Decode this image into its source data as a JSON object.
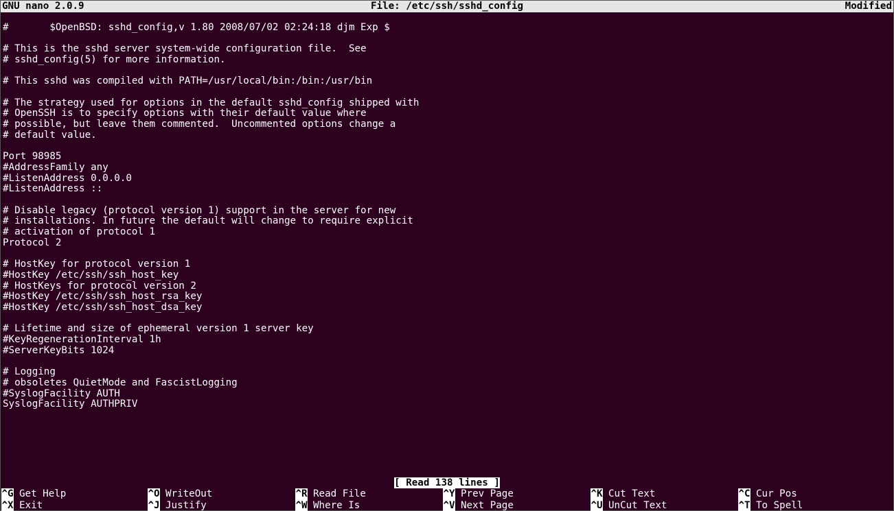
{
  "titlebar": {
    "app": "  GNU nano 2.0.9",
    "file": "File: /etc/ssh/sshd_config",
    "status": "Modified  "
  },
  "content": [
    "",
    "#       $OpenBSD: sshd_config,v 1.80 2008/07/02 02:24:18 djm Exp $",
    "",
    "# This is the sshd server system-wide configuration file.  See",
    "# sshd_config(5) for more information.",
    "",
    "# This sshd was compiled with PATH=/usr/local/bin:/bin:/usr/bin",
    "",
    "# The strategy used for options in the default sshd_config shipped with",
    "# OpenSSH is to specify options with their default value where",
    "# possible, but leave them commented.  Uncommented options change a",
    "# default value.",
    "",
    "Port 98985",
    "#AddressFamily any",
    "#ListenAddress 0.0.0.0",
    "#ListenAddress ::",
    "",
    "# Disable legacy (protocol version 1) support in the server for new",
    "# installations. In future the default will change to require explicit",
    "# activation of protocol 1",
    "Protocol 2",
    "",
    "# HostKey for protocol version 1",
    "#HostKey /etc/ssh/ssh_host_key",
    "# HostKeys for protocol version 2",
    "#HostKey /etc/ssh/ssh_host_rsa_key",
    "#HostKey /etc/ssh/ssh_host_dsa_key",
    "",
    "# Lifetime and size of ephemeral version 1 server key",
    "#KeyRegenerationInterval 1h",
    "#ServerKeyBits 1024",
    "",
    "# Logging",
    "# obsoletes QuietMode and FascistLogging",
    "#SyslogFacility AUTH",
    "SyslogFacility AUTHPRIV"
  ],
  "status": {
    "bl": "[ ",
    "msg": "Read 138 lines",
    "br": " ]"
  },
  "menu": {
    "row1": [
      {
        "key": "^G",
        "label": "Get Help"
      },
      {
        "key": "^O",
        "label": "WriteOut"
      },
      {
        "key": "^R",
        "label": "Read File"
      },
      {
        "key": "^Y",
        "label": "Prev Page"
      },
      {
        "key": "^K",
        "label": "Cut Text"
      },
      {
        "key": "^C",
        "label": "Cur Pos"
      }
    ],
    "row2": [
      {
        "key": "^X",
        "label": "Exit"
      },
      {
        "key": "^J",
        "label": "Justify"
      },
      {
        "key": "^W",
        "label": "Where Is"
      },
      {
        "key": "^V",
        "label": "Next Page"
      },
      {
        "key": "^U",
        "label": "UnCut Text"
      },
      {
        "key": "^T",
        "label": "To Spell"
      }
    ]
  }
}
